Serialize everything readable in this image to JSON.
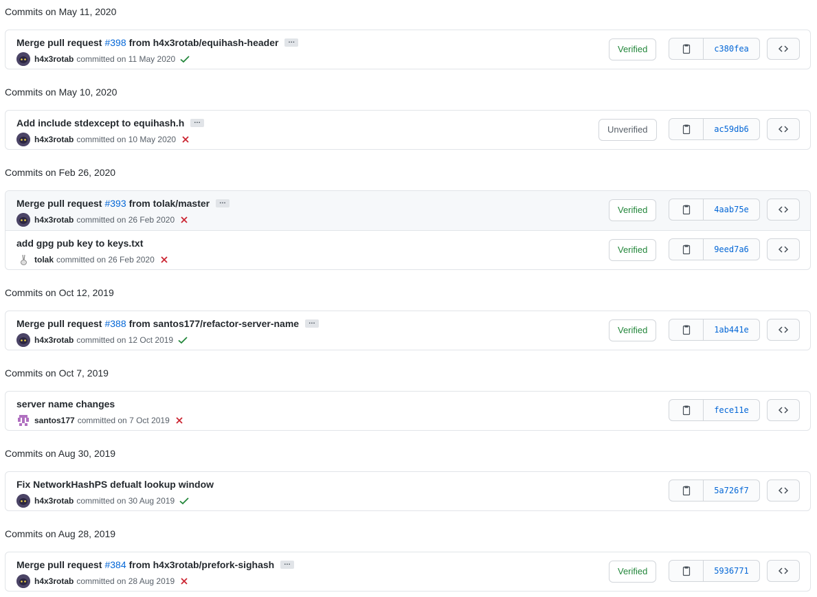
{
  "groups": [
    {
      "header": "Commits on May 11, 2020",
      "commits": [
        {
          "message_before": "Merge pull request",
          "pr": "#398",
          "message_after": "from h4x3rotab/equihash-header",
          "ellipsis": true,
          "author": "h4x3rotab",
          "committed_on": "committed on 11 May 2020",
          "status": "success",
          "badge": "Verified",
          "sha": "c380fea",
          "avatar": "dark",
          "highlighted": false
        }
      ]
    },
    {
      "header": "Commits on May 10, 2020",
      "commits": [
        {
          "message_before": "Add include stdexcept to equihash.h",
          "pr": "",
          "message_after": "",
          "ellipsis": true,
          "author": "h4x3rotab",
          "committed_on": "committed on 10 May 2020",
          "status": "failure",
          "badge": "Unverified",
          "sha": "ac59db6",
          "avatar": "dark",
          "highlighted": false
        }
      ]
    },
    {
      "header": "Commits on Feb 26, 2020",
      "commits": [
        {
          "message_before": "Merge pull request",
          "pr": "#393",
          "message_after": "from tolak/master",
          "ellipsis": true,
          "author": "h4x3rotab",
          "committed_on": "committed on 26 Feb 2020",
          "status": "failure",
          "badge": "Verified",
          "sha": "4aab75e",
          "avatar": "dark",
          "highlighted": true
        },
        {
          "message_before": "add gpg pub key to keys.txt",
          "pr": "",
          "message_after": "",
          "ellipsis": false,
          "author": "tolak",
          "committed_on": "committed on 26 Feb 2020",
          "status": "failure",
          "badge": "Verified",
          "sha": "9eed7a6",
          "avatar": "light",
          "highlighted": false
        }
      ]
    },
    {
      "header": "Commits on Oct 12, 2019",
      "commits": [
        {
          "message_before": "Merge pull request",
          "pr": "#388",
          "message_after": "from santos177/refactor-server-name",
          "ellipsis": true,
          "author": "h4x3rotab",
          "committed_on": "committed on 12 Oct 2019",
          "status": "success",
          "badge": "Verified",
          "sha": "1ab441e",
          "avatar": "dark",
          "highlighted": false
        }
      ]
    },
    {
      "header": "Commits on Oct 7, 2019",
      "commits": [
        {
          "message_before": "server name changes",
          "pr": "",
          "message_after": "",
          "ellipsis": false,
          "author": "santos177",
          "committed_on": "committed on 7 Oct 2019",
          "status": "failure",
          "badge": "",
          "sha": "fece11e",
          "avatar": "pixel",
          "highlighted": false
        }
      ]
    },
    {
      "header": "Commits on Aug 30, 2019",
      "commits": [
        {
          "message_before": "Fix NetworkHashPS defualt lookup window",
          "pr": "",
          "message_after": "",
          "ellipsis": false,
          "author": "h4x3rotab",
          "committed_on": "committed on 30 Aug 2019",
          "status": "success",
          "badge": "",
          "sha": "5a726f7",
          "avatar": "dark",
          "highlighted": false
        }
      ]
    },
    {
      "header": "Commits on Aug 28, 2019",
      "commits": [
        {
          "message_before": "Merge pull request",
          "pr": "#384",
          "message_after": "from h4x3rotab/prefork-sighash",
          "ellipsis": true,
          "author": "h4x3rotab",
          "committed_on": "committed on 28 Aug 2019",
          "status": "failure",
          "badge": "Verified",
          "sha": "5936771",
          "avatar": "dark",
          "highlighted": false
        }
      ]
    }
  ],
  "labels": {
    "ellipsis": "…"
  },
  "colors": {
    "verified": "#22863a",
    "failure": "#cb2431",
    "link": "#0366d6",
    "border": "#e1e4e8"
  }
}
